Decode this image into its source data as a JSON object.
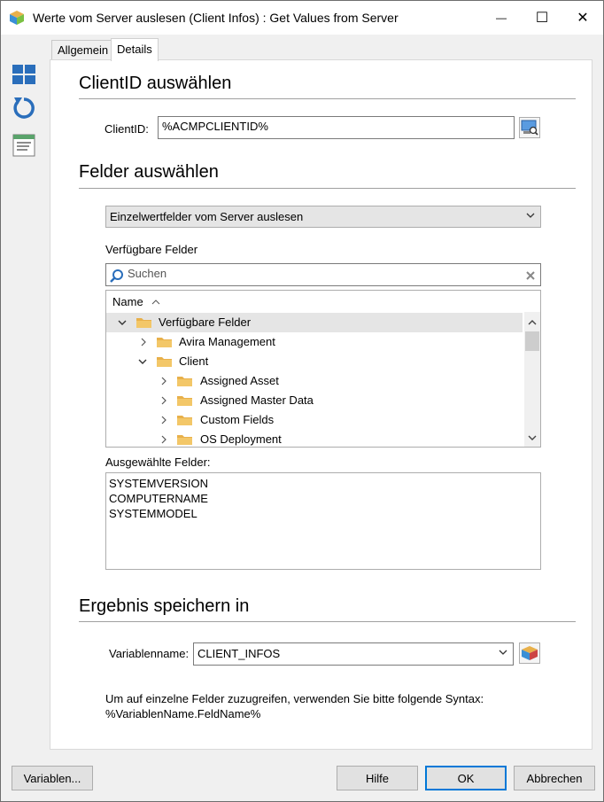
{
  "window": {
    "title": "Werte vom Server auslesen (Client Infos) : Get Values from Server",
    "minimize_glyph": "—",
    "maximize_glyph": "☐",
    "close_glyph": "✕"
  },
  "sidebar": {
    "items": [
      {
        "icon": "grid-icon"
      },
      {
        "icon": "refresh-icon"
      },
      {
        "icon": "form-icon"
      }
    ]
  },
  "tabs": [
    {
      "label": "Allgemein",
      "active": false
    },
    {
      "label": "Details",
      "active": true
    }
  ],
  "client_section": {
    "title": "ClientID auswählen",
    "clientid_label": "ClientID:",
    "clientid_value": "%ACMPCLIENTID%"
  },
  "fields_section": {
    "title": "Felder auswählen",
    "mode_value": "Einzelwertfelder vom Server auslesen",
    "available_label": "Verfügbare Felder",
    "search_placeholder": "Suchen",
    "tree_column": "Name",
    "tree": [
      {
        "label": "Verfügbare Felder",
        "level": 0,
        "expanded": true,
        "selected": true
      },
      {
        "label": "Avira Management",
        "level": 1,
        "expanded": false
      },
      {
        "label": "Client",
        "level": 1,
        "expanded": true
      },
      {
        "label": "Assigned Asset",
        "level": 2,
        "expanded": false
      },
      {
        "label": "Assigned Master Data",
        "level": 2,
        "expanded": false
      },
      {
        "label": "Custom Fields",
        "level": 2,
        "expanded": false
      },
      {
        "label": "OS Deployment",
        "level": 2,
        "expanded": false
      }
    ],
    "selected_label": "Ausgewählte Felder:",
    "selected_fields": [
      "SYSTEMVERSION",
      "COMPUTERNAME",
      "SYSTEMMODEL"
    ]
  },
  "result_section": {
    "title": "Ergebnis speichern in",
    "varname_label": "Variablenname:",
    "varname_value": "CLIENT_INFOS",
    "hint_line1": "Um auf einzelne Felder zuzugreifen, verwenden Sie bitte folgende Syntax:",
    "hint_line2": "%VariablenName.FeldName%"
  },
  "footer": {
    "variables_label": "Variablen...",
    "help_label": "Hilfe",
    "ok_label": "OK",
    "cancel_label": "Abbrechen"
  },
  "colors": {
    "accent": "#0078d7",
    "folder": "#e8b04a",
    "sidebar_icon": "#2a6ebb"
  }
}
